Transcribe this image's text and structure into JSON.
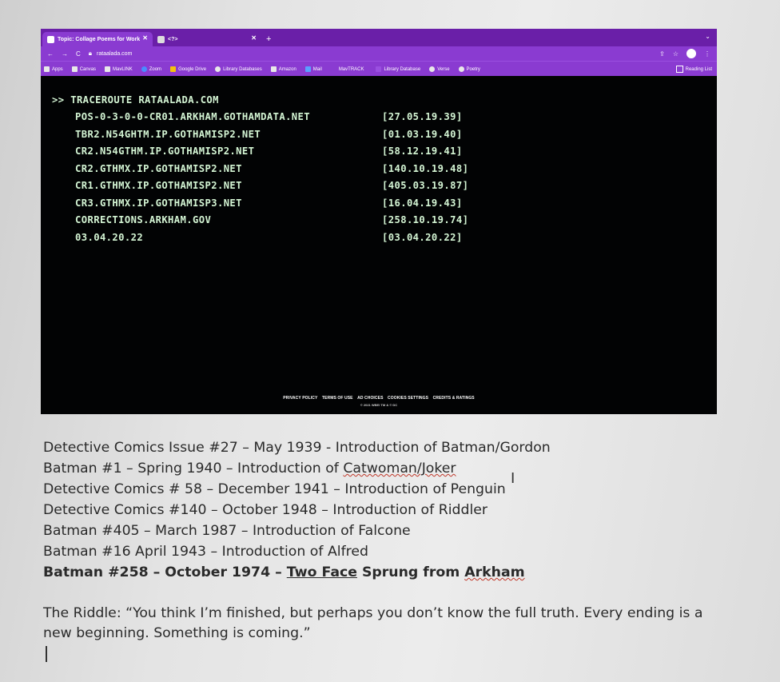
{
  "browser": {
    "tabs": [
      {
        "title": "Topic: Collage Poems for Work",
        "active": true
      },
      {
        "title": "<?>",
        "active": false
      }
    ],
    "new_tab": "+",
    "url": "rataalada.com",
    "bookmarks": [
      "Apps",
      "Canvas",
      "MavLINK",
      "Zoom",
      "Google Drive",
      "Library Databases",
      "Amazon",
      "Mail",
      "MavTRACK",
      "Library Database",
      "Verse",
      "Poetry"
    ],
    "reading_list": "Reading List"
  },
  "terminal": {
    "command": ">> TRACEROUTE RATAALADA.COM",
    "hops": [
      {
        "host": "POS-0-3-0-0-CR01.ARKHAM.GOTHAMDATA.NET",
        "ip": "[27.05.19.39]"
      },
      {
        "host": "TBR2.N54GHTM.IP.GOTHAMISP2.NET",
        "ip": "[01.03.19.40]"
      },
      {
        "host": "CR2.N54GTHM.IP.GOTHAMISP2.NET",
        "ip": "[58.12.19.41]"
      },
      {
        "host": "CR2.GTHMX.IP.GOTHAMISP2.NET",
        "ip": "[140.10.19.48]"
      },
      {
        "host": "CR1.GTHMX.IP.GOTHAMISP2.NET",
        "ip": "[405.03.19.87]"
      },
      {
        "host": "CR3.GTHMX.IP.GOTHAMISP3.NET",
        "ip": "[16.04.19.43]"
      },
      {
        "host": "CORRECTIONS.ARKHAM.GOV",
        "ip": "[258.10.19.74]"
      },
      {
        "host": "03.04.20.22",
        "ip": "[03.04.20.22]"
      }
    ],
    "footer_links": [
      "PRIVACY POLICY",
      "TERMS OF USE",
      "AD CHOICES",
      "COOKIES SETTINGS",
      "CREDITS & RATINGS"
    ],
    "footer_copy": "© 2021 WBEI TM & © DC"
  },
  "document": {
    "lines": [
      "Detective Comics Issue #27 – May 1939 - Introduction of Batman/Gordon",
      "Batman #1 – Spring 1940 – Introduction of Catwoman/Joker",
      "Detective Comics # 58 – December 1941 – Introduction of Penguin",
      "Detective Comics #140 – October 1948 – Introduction of Riddler",
      "Batman #405 – March 1987 – Introduction of Falcone",
      "Batman #16 April 1943 – Introduction of Alfred"
    ],
    "last_line_prefix": "Batman #258 – October 1974 – ",
    "last_line_link": "Two Face",
    "last_line_mid": " Sprung from ",
    "last_line_end": "Arkham",
    "riddle": "The Riddle: “You think I’m finished, but perhaps you don’t know the full truth. Every ending is a new beginning. Something is coming.”"
  }
}
